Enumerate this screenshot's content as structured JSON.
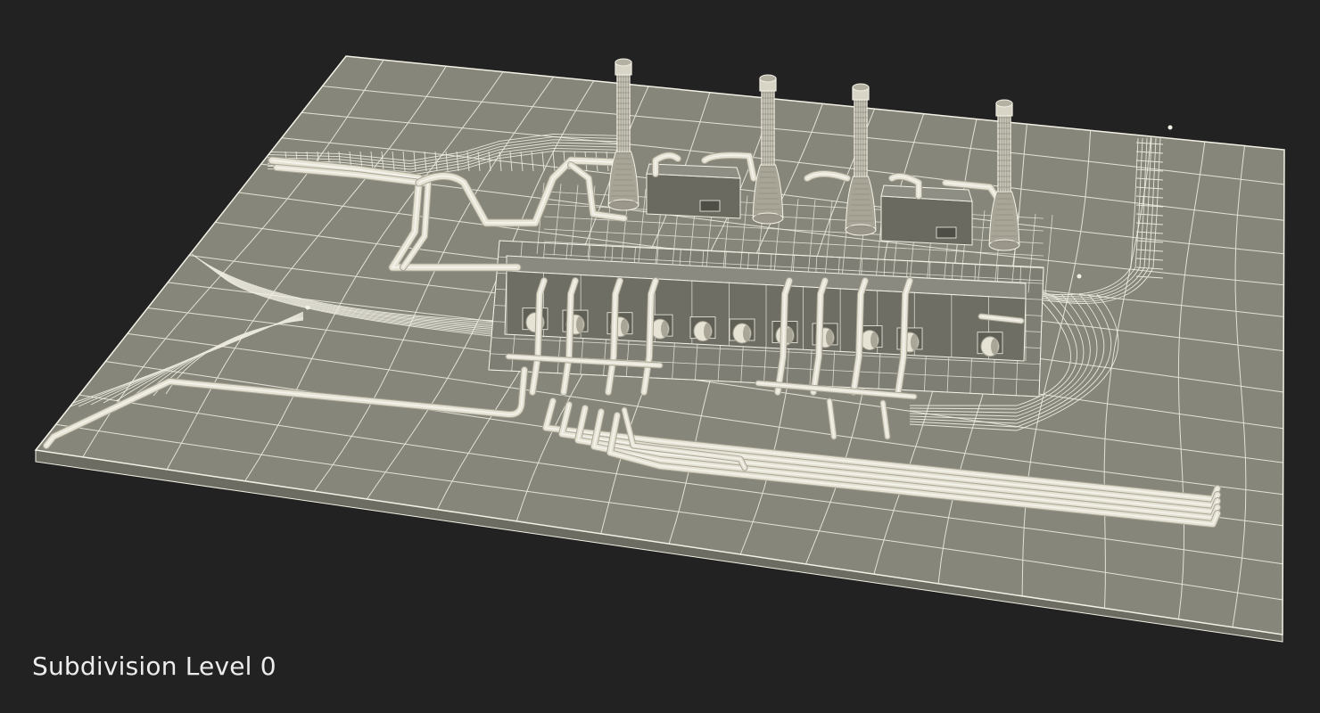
{
  "caption": {
    "text": "Subdivision Level 0"
  },
  "scene": {
    "subject": "power-plant-wireframe-model",
    "colors": {
      "background": "#222222",
      "ground_fill": "#86867a",
      "ground_edge": "#6c6c62",
      "wire": "#f4f2e6",
      "pipe": "#e6e3d4",
      "pipe_shadow": "#a9a698",
      "building_fill": "#7c7c71",
      "building_dark": "#5f5f56",
      "caption": "#ececec"
    }
  }
}
